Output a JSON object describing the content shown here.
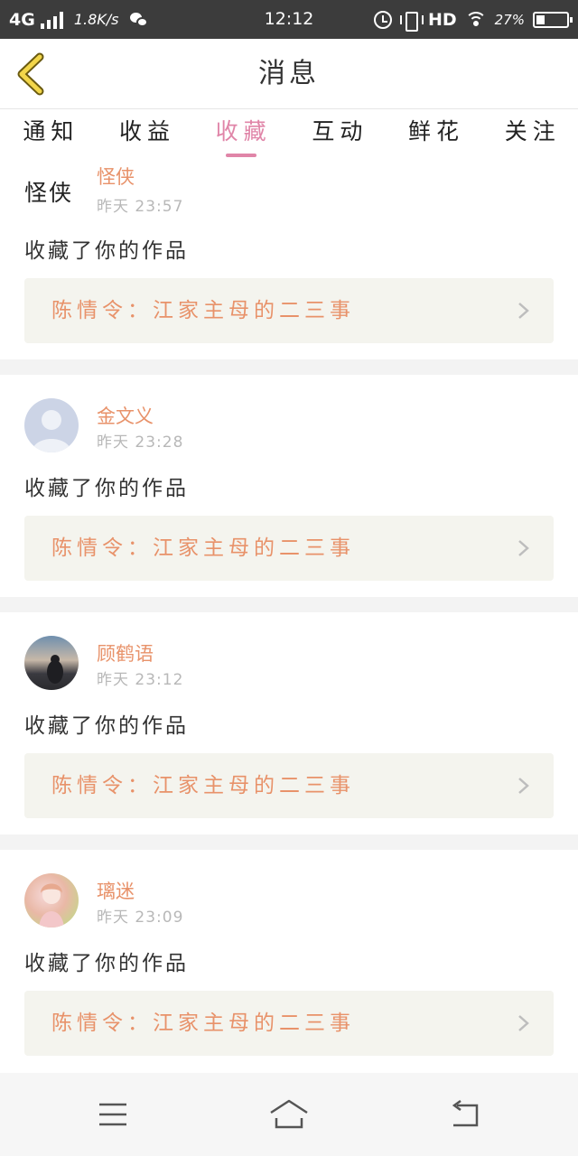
{
  "status_bar": {
    "network": "4G",
    "speed": "1.8K/s",
    "time": "12:12",
    "hd": "HD",
    "battery": "27%",
    "battery_level": 0.27,
    "icons": [
      "signal-icon",
      "wechat-icon",
      "alarm-icon",
      "vibrate-icon",
      "wifi-icon",
      "battery-icon"
    ]
  },
  "header": {
    "title": "消息",
    "back_icon": "chevron-left-icon"
  },
  "tabs": [
    {
      "label": "通知",
      "active": false
    },
    {
      "label": "收益",
      "active": false
    },
    {
      "label": "收藏",
      "active": true
    },
    {
      "label": "互动",
      "active": false
    },
    {
      "label": "鲜花",
      "active": false
    },
    {
      "label": "关注",
      "active": false
    }
  ],
  "notifications": [
    {
      "avatar_text": "怪侠",
      "username": "怪侠",
      "time": "昨天 23:57",
      "action": "收藏了你的作品",
      "work_title": "陈情令：江家主母的二三事"
    },
    {
      "avatar_text": "",
      "username": "金文义",
      "time": "昨天 23:28",
      "action": "收藏了你的作品",
      "work_title": "陈情令：江家主母的二三事"
    },
    {
      "avatar_text": "",
      "username": "顾鹤语",
      "time": "昨天 23:12",
      "action": "收藏了你的作品",
      "work_title": "陈情令：江家主母的二三事"
    },
    {
      "avatar_text": "",
      "username": "璃迷",
      "time": "昨天 23:09",
      "action": "收藏了你的作品",
      "work_title": "陈情令：江家主母的二三事"
    }
  ],
  "nav_bar": {
    "icons": [
      "menu-icon",
      "home-icon",
      "back-icon"
    ]
  },
  "colors": {
    "accent": "#e085a8",
    "username": "#e8926a",
    "status_bar_bg": "#3c3c3c",
    "card_link_bg": "#f4f4ee"
  }
}
